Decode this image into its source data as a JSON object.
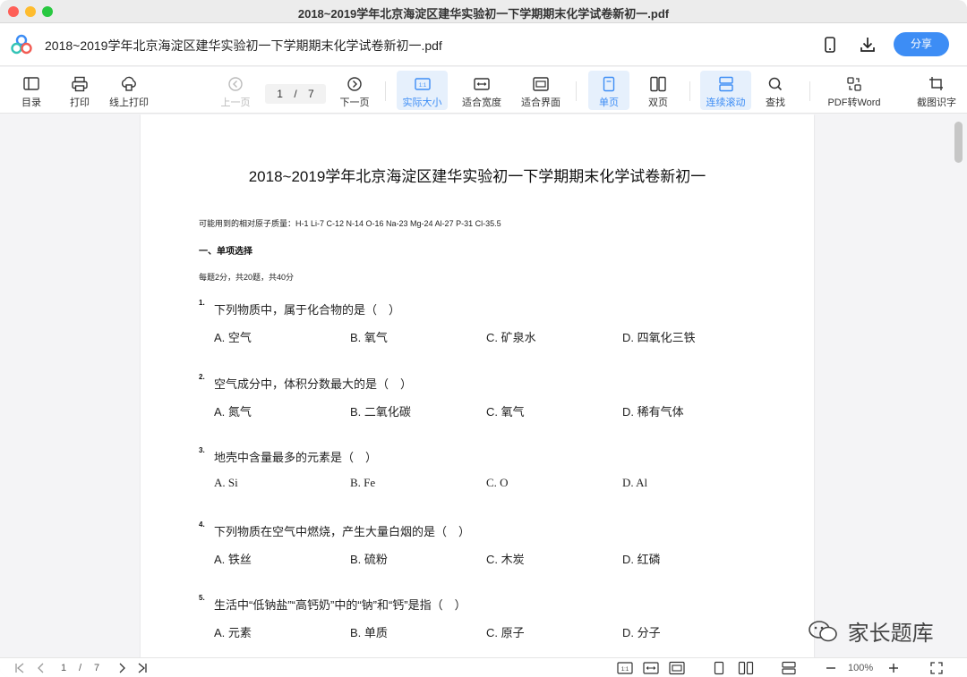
{
  "window": {
    "title": "2018~2019学年北京海淀区建华实验初一下学期期末化学试卷新初一.pdf"
  },
  "header": {
    "doc_title": "2018~2019学年北京海淀区建华实验初一下学期期末化学试卷新初一.pdf",
    "share_label": "分享",
    "icons": [
      "app-logo",
      "phone-icon",
      "download-icon"
    ]
  },
  "toolbar": {
    "toc": "目录",
    "print": "打印",
    "online_print": "线上打印",
    "prev_page": "上一页",
    "page_current": "1",
    "page_sep": "/",
    "page_total": "7",
    "next_page": "下一页",
    "actual_size": "实际大小",
    "actual_size_icon_text": "1:1",
    "fit_width": "适合宽度",
    "fit_page": "适合界面",
    "single_page": "单页",
    "double_page": "双页",
    "continuous": "连续滚动",
    "find": "查找",
    "pdf_to_word": "PDF转Word",
    "ocr": "截图识字"
  },
  "document": {
    "heading": "2018~2019学年北京海淀区建华实验初一下学期期末化学试卷新初一",
    "atomic_masses": "可能用到的相对原子质量：H-1  Li-7  C-12  N-14  O-16  Na-23  Mg-24  Al-27  P-31  Cl-35.5",
    "section_title": "一、单项选择",
    "section_note": "每题2分，共20题，共40分",
    "questions": [
      {
        "num": "1.",
        "text": "下列物质中，属于化合物的是（　）",
        "options": [
          "A. 空气",
          "B. 氧气",
          "C. 矿泉水",
          "D. 四氧化三铁"
        ]
      },
      {
        "num": "2.",
        "text": "空气成分中，体积分数最大的是（　）",
        "options": [
          "A. 氮气",
          "B. 二氧化碳",
          "C. 氧气",
          "D. 稀有气体"
        ]
      },
      {
        "num": "3.",
        "text": "地壳中含量最多的元素是（　）",
        "options": [
          "A. Si",
          "B. Fe",
          "C. O",
          "D. Al"
        ]
      },
      {
        "num": "4.",
        "text": "下列物质在空气中燃烧，产生大量白烟的是（　）",
        "options": [
          "A. 铁丝",
          "B. 硫粉",
          "C. 木炭",
          "D. 红磷"
        ]
      },
      {
        "num": "5.",
        "text": "生活中“低钠盐”“高钙奶”中的“钠”和“钙”是指（　）",
        "options": [
          "A. 元素",
          "B. 单质",
          "C. 原子",
          "D. 分子"
        ]
      }
    ]
  },
  "watermark": {
    "text": "家长题库"
  },
  "statusbar": {
    "page_current": "1",
    "page_sep": "/",
    "page_total": "7",
    "zoom": "100%",
    "actual_size_icon_text": "1:1"
  },
  "colors": {
    "accent": "#3d8df5",
    "active_bg": "#e6f0fc"
  }
}
